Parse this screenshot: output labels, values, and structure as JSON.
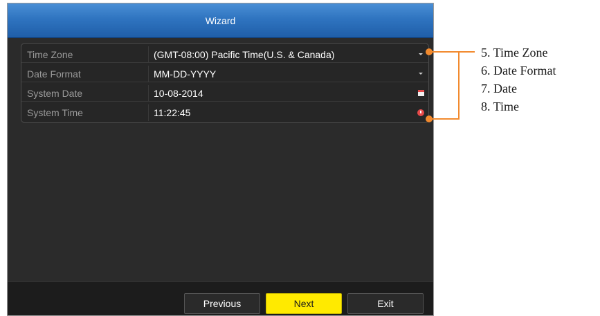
{
  "window": {
    "title": "Wizard"
  },
  "fields": [
    {
      "label": "Time Zone",
      "value": "(GMT-08:00) Pacific Time(U.S. & Canada)",
      "control": "chevron-down-icon"
    },
    {
      "label": "Date Format",
      "value": "MM-DD-YYYY",
      "control": "chevron-down-icon"
    },
    {
      "label": "System Date",
      "value": "10-08-2014",
      "control": "calendar-icon"
    },
    {
      "label": "System Time",
      "value": "11:22:45",
      "control": "clock-icon"
    }
  ],
  "buttons": {
    "previous": "Previous",
    "next": "Next",
    "exit": "Exit"
  },
  "annotations": [
    "5. Time Zone",
    "6. Date Format",
    "7. Date",
    "8. Time"
  ],
  "colors": {
    "accent": "#f28a2e",
    "next_button": "#ffea00",
    "title_bar": "#2f74c0"
  }
}
